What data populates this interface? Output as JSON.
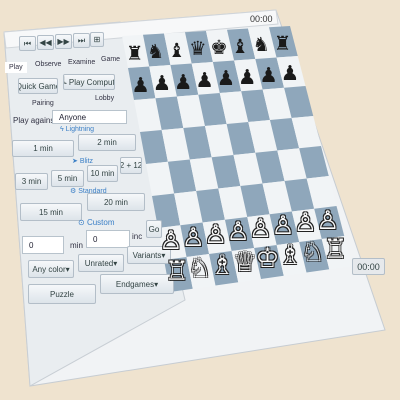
{
  "clock_top": "00:00",
  "clock_bottom": "00:00",
  "nav_icons": [
    "skip-back-icon",
    "step-back-icon",
    "step-forward-icon",
    "skip-forward-icon",
    "board-icon"
  ],
  "tabs": [
    "Play",
    "Observe",
    "Examine",
    "Game"
  ],
  "quick_game": "Quick Game",
  "play_computer": "Play Computer",
  "subtabs": [
    "Pairing",
    "Lobby"
  ],
  "play_against_label": "Play against",
  "play_against_value": "Anyone",
  "sections": {
    "lightning": "Lightning",
    "blitz": "Blitz",
    "standard": "Standard",
    "custom": "Custom"
  },
  "lightning_times": [
    "1 min",
    "2 min"
  ],
  "blitz_times": [
    "3 min",
    "5 min",
    "10 min",
    "2 + 12"
  ],
  "standard_times": [
    "15 min",
    "20 min"
  ],
  "custom": {
    "min_value": "0",
    "min_label": "min",
    "inc_value": "0",
    "inc_label": "inc",
    "go": "Go"
  },
  "dropdowns": [
    "Any color",
    "Unrated",
    "Variants"
  ],
  "bottom_buttons": [
    "Puzzle",
    "Endgames"
  ],
  "board": {
    "light": "#f1f4f6",
    "dark": "#8fa7bb",
    "ranks": [
      [
        "♜",
        "♞",
        "♝",
        "♛",
        "♚",
        "♝",
        "♞",
        "♜"
      ],
      [
        "♟",
        "♟",
        "♟",
        "♟",
        "♟",
        "♟",
        "♟",
        "♟"
      ],
      [
        "",
        "",
        "",
        "",
        "",
        "",
        "",
        ""
      ],
      [
        "",
        "",
        "",
        "",
        "",
        "",
        "",
        ""
      ],
      [
        "",
        "",
        "",
        "",
        "",
        "",
        "",
        ""
      ],
      [
        "",
        "",
        "",
        "",
        "",
        "",
        "",
        ""
      ],
      [
        "♙",
        "♙",
        "♙",
        "♙",
        "♙",
        "♙",
        "♙",
        "♙"
      ],
      [
        "♖",
        "♘",
        "♗",
        "♕",
        "♔",
        "♗",
        "♘",
        "♖"
      ]
    ]
  }
}
